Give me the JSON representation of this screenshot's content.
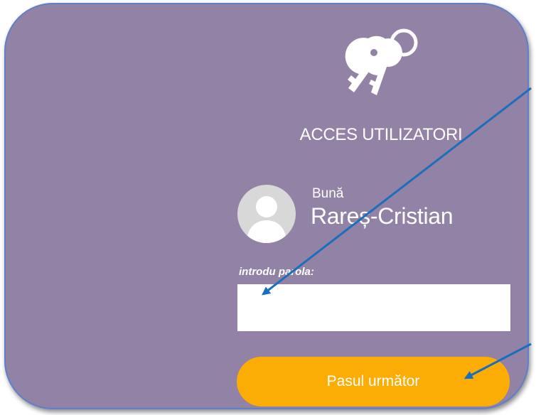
{
  "login": {
    "title": "ACCES UTILIZATORI",
    "greeting": "Bună",
    "username": "Rareș-Cristian",
    "password_label": "introdu parola:",
    "password_value": "",
    "next_button_label": "Pasul următor"
  },
  "icons": {
    "header": "keys-icon",
    "avatar": "user-avatar-icon"
  },
  "colors": {
    "panel_background": "#9282a6",
    "panel_border": "#5f7fc9",
    "button_background": "#fbac05",
    "annotation_arrow": "#1a6fbd"
  }
}
